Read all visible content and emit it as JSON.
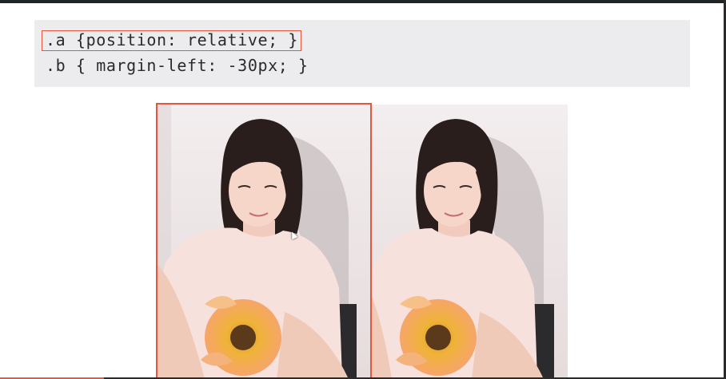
{
  "code": {
    "line1": ".a {position: relative; }",
    "line2": ".b { margin-left: -30px; }"
  },
  "images": [
    {
      "name": "photo-a",
      "description_icon": "selfie-photo"
    },
    {
      "name": "photo-b",
      "description_icon": "selfie-photo"
    }
  ],
  "colors": {
    "accent": "#e4573d",
    "code_panel_bg": "#ececee",
    "topbar": "#1f2427"
  }
}
